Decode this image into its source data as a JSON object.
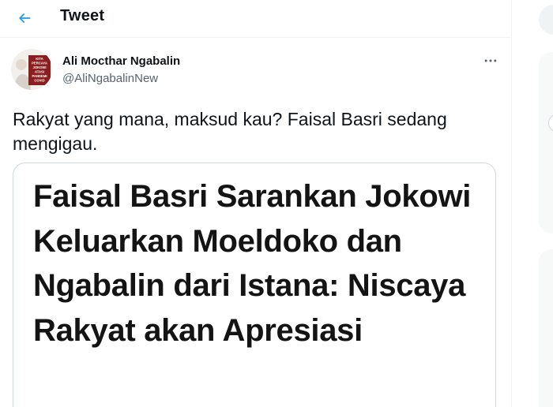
{
  "header": {
    "title": "Tweet"
  },
  "tweet": {
    "author": {
      "display_name": "Ali Mocthar Ngabalin",
      "handle": "@AliNgabalinNew",
      "avatar_badge": [
        "KITA",
        "PERCAYA",
        "JOKOWI",
        "ATASI",
        "PANDEMI",
        "COVID"
      ]
    },
    "text": "Rakyat yang mana, maksud kau? Faisal Basri sedang mengigau.",
    "media": {
      "headline": "Faisal Basri Sarankan Jokowi Keluarkan Moeldoko dan Ngabalin dari Istana: Niscaya Rakyat akan Apresiasi"
    }
  },
  "colors": {
    "accent": "#1d9bf0",
    "text_primary": "#0f1419",
    "text_secondary": "#536471",
    "border": "#cfd9de",
    "avatar_badge_bg": "#8b1e1e"
  },
  "icons": {
    "back": "back-arrow-icon",
    "more": "more-horizontal-icon"
  }
}
